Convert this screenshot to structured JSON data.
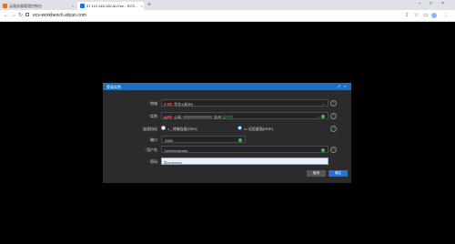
{
  "browser": {
    "tabs": [
      {
        "title": "云服务器管理控制台",
        "state": "inactive"
      },
      {
        "title": "47.110.148.126 ALIYun - ECS ...",
        "state": "active"
      }
    ],
    "new_tab": "+",
    "window_controls": [
      "–",
      "□",
      "×"
    ],
    "url": "ecs-workbench.aliyun.com"
  },
  "dialog": {
    "title": "登录实例",
    "region": {
      "label": "地域",
      "value": "华东1(杭州)"
    },
    "instance": {
      "label": "实例",
      "name": "公网",
      "zone": "杭州",
      "status": "运行中"
    },
    "connect": {
      "label": "连接协议",
      "options": [
        "终端连接(SSH)",
        "远程桌面(RDP)"
      ],
      "selected": "远程桌面(RDP)"
    },
    "port": {
      "label": "端口",
      "value": "3389"
    },
    "username": {
      "label": "用户名",
      "value": "Administrator"
    },
    "password": {
      "label": "密码",
      "value": "••••••••••••"
    },
    "cancel_label": "取消",
    "ok_label": "确定"
  },
  "colors": {
    "accent": "#1f6fc0",
    "ok": "#3fb950",
    "required": "#e64545"
  }
}
